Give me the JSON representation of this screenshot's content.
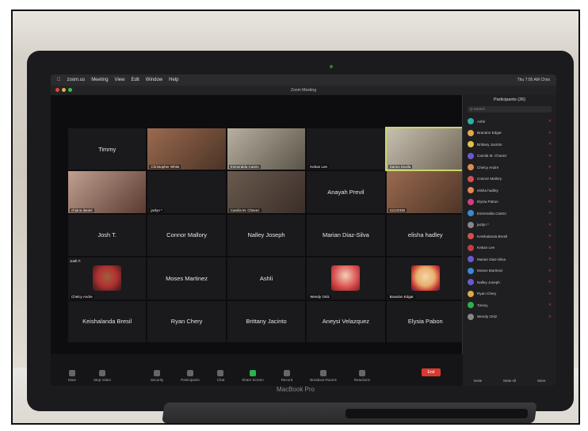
{
  "menubar": {
    "app": "zoom.us",
    "items": [
      "Meeting",
      "View",
      "Edit",
      "Window",
      "Help"
    ],
    "clock": "Thu 7:05 AM  Chris"
  },
  "window_title": "Zoom Meeting",
  "grid": [
    {
      "name": "Timmy",
      "type": "text"
    },
    {
      "name": "Christopher White",
      "type": "video"
    },
    {
      "name": "Esmeralda Castro",
      "type": "video"
    },
    {
      "name": "Keban Lee",
      "type": "blank"
    },
    {
      "name": "Darius Davila",
      "type": "video",
      "highlight": true
    },
    {
      "name": "chiana daniel",
      "type": "video"
    },
    {
      "name": "jazlyn *",
      "type": "blank"
    },
    {
      "name": "Camila M. Chavez",
      "type": "video"
    },
    {
      "name": "Anayah Previl",
      "type": "text"
    },
    {
      "name": "11123336",
      "type": "video"
    },
    {
      "name": "Josh T.",
      "type": "text"
    },
    {
      "name": "Connor Mallory",
      "type": "text"
    },
    {
      "name": "Nalley Joseph",
      "type": "text"
    },
    {
      "name": "Marian Diaz-Silva",
      "type": "text"
    },
    {
      "name": "elisha hadley",
      "type": "text"
    },
    {
      "name": "Chelcy Andre",
      "type": "avatar",
      "corner": "Josh T."
    },
    {
      "name": "Moses Martinez",
      "type": "text"
    },
    {
      "name": "Ashli",
      "type": "text"
    },
    {
      "name": "Wendy Ortiz",
      "type": "avatar"
    },
    {
      "name": "Brandon Edgar",
      "type": "avatar"
    },
    {
      "name": "Keishalanda Bresil",
      "type": "text"
    },
    {
      "name": "Ryan Chery",
      "type": "text"
    },
    {
      "name": "Brittany Jacinto",
      "type": "text"
    },
    {
      "name": "Aneysi Velazquez",
      "type": "text"
    },
    {
      "name": "Elysia Pabon",
      "type": "text"
    }
  ],
  "participants": {
    "title": "Participants (26)",
    "search_placeholder": "Q Search",
    "list": [
      {
        "name": "Ashli",
        "color": "#2bb2a4"
      },
      {
        "name": "Brandon Edgar",
        "color": "#e0a84c"
      },
      {
        "name": "Brittany Jacinto",
        "color": "#e0c04c"
      },
      {
        "name": "Camila M. Chavez",
        "color": "#6a5acd"
      },
      {
        "name": "Chelcy Andre",
        "color": "#e08a4c"
      },
      {
        "name": "Connor Mallory",
        "color": "#d05050"
      },
      {
        "name": "elisha hadley",
        "color": "#e08a4c"
      },
      {
        "name": "Elysia Pabon",
        "color": "#d04080"
      },
      {
        "name": "Esmeralda Castro",
        "color": "#3a8ad0"
      },
      {
        "name": "jazlyn *",
        "color": "#888888"
      },
      {
        "name": "Keishalanda Bresil",
        "color": "#d05050"
      },
      {
        "name": "Keban Lee",
        "color": "#c04040"
      },
      {
        "name": "Marian Diaz-Silva",
        "color": "#6a5acd"
      },
      {
        "name": "Moses Martinez",
        "color": "#3a8ad0"
      },
      {
        "name": "Nalley Joseph",
        "color": "#6a5acd"
      },
      {
        "name": "Ryan Chery",
        "color": "#e0a84c"
      },
      {
        "name": "Timmy",
        "color": "#2bb24c"
      },
      {
        "name": "Wendy Ortiz",
        "color": "#888888"
      }
    ],
    "footer": [
      "Invite",
      "Mute All",
      "More"
    ]
  },
  "toolbar": {
    "items": [
      "Security",
      "Participants",
      "Chat",
      "Share Screen",
      "Record",
      "Breakout Rooms",
      "Reactions"
    ],
    "left": [
      "Mute",
      "Stop Video"
    ],
    "end_label": "End"
  },
  "brand": "MacBook Pro"
}
